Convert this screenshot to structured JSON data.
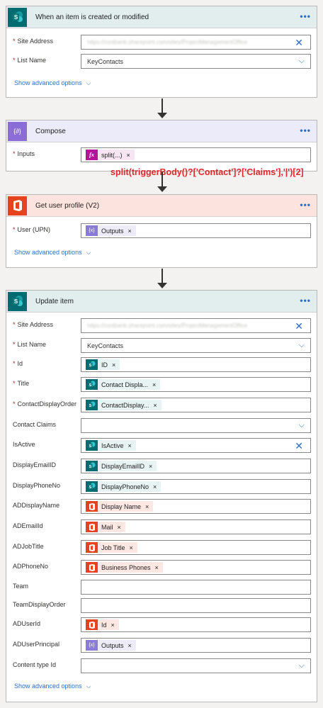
{
  "colors": {
    "sharepoint": "#036c70",
    "office": "#e6421d",
    "compose": "#8c6cd6",
    "variable": "#8a7bd8",
    "accent": "#2b6fc4",
    "annotation": "#e0282d"
  },
  "trigger": {
    "title": "When an item is created or modified",
    "icon": "sharepoint-icon",
    "fields": [
      {
        "label": "Site Address",
        "required": true,
        "value": "https://coolbank.sharepoint.com/sites/ProjectManagementOffice"
      },
      {
        "label": "List Name",
        "required": true,
        "value": "KeyContacts"
      }
    ],
    "advanced": "Show advanced options"
  },
  "compose": {
    "title": "Compose",
    "icon": "compose-icon",
    "inputs_label": "Inputs",
    "token": "split(...)",
    "annotation": "split(triggerBody()?['Contact']?['Claims'],'|')[2]"
  },
  "profile": {
    "title": "Get user profile (V2)",
    "icon": "office365-icon",
    "user_label": "User (UPN)",
    "token": "Outputs",
    "advanced": "Show advanced options"
  },
  "update": {
    "title": "Update item",
    "icon": "sharepoint-icon",
    "fields": [
      {
        "label": "Site Address",
        "required": true,
        "kind": "text",
        "value": "https://coolbank.sharepoint.com/sites/ProjectManagementOffice",
        "control": "clear"
      },
      {
        "label": "List Name",
        "required": true,
        "kind": "text",
        "value": "KeyContacts",
        "control": "dropdown"
      },
      {
        "label": "Id",
        "required": true,
        "kind": "token",
        "icon": "sp",
        "token": "ID"
      },
      {
        "label": "Title",
        "required": true,
        "kind": "token",
        "icon": "sp",
        "token": "Contact Displa..."
      },
      {
        "label": "ContactDisplayOrder",
        "required": true,
        "kind": "token",
        "icon": "sp",
        "token": "ContactDisplay..."
      },
      {
        "label": "Contact Claims",
        "required": false,
        "kind": "empty",
        "control": "dropdown"
      },
      {
        "label": "IsActive",
        "required": false,
        "kind": "token",
        "icon": "sp",
        "token": "IsActive",
        "control": "clear"
      },
      {
        "label": "DisplayEmailID",
        "required": false,
        "kind": "token",
        "icon": "sp",
        "token": "DisplayEmailID"
      },
      {
        "label": "DisplayPhoneNo",
        "required": false,
        "kind": "token",
        "icon": "sp",
        "token": "DisplayPhoneNo"
      },
      {
        "label": "ADDisplayName",
        "required": false,
        "kind": "token",
        "icon": "o365",
        "token": "Display Name"
      },
      {
        "label": "ADEmailId",
        "required": false,
        "kind": "token",
        "icon": "o365",
        "token": "Mail"
      },
      {
        "label": "ADJobTitle",
        "required": false,
        "kind": "token",
        "icon": "o365",
        "token": "Job Title"
      },
      {
        "label": "ADPhoneNo",
        "required": false,
        "kind": "token",
        "icon": "o365",
        "token": "Business Phones"
      },
      {
        "label": "Team",
        "required": false,
        "kind": "empty"
      },
      {
        "label": "TeamDisplayOrder",
        "required": false,
        "kind": "empty"
      },
      {
        "label": "ADUserId",
        "required": false,
        "kind": "token",
        "icon": "o365",
        "token": "Id"
      },
      {
        "label": "ADUserPrincipal",
        "required": false,
        "kind": "token",
        "icon": "var",
        "token": "Outputs"
      },
      {
        "label": "Content type Id",
        "required": false,
        "kind": "empty",
        "control": "dropdown"
      }
    ],
    "advanced": "Show advanced options"
  },
  "glyphs": {
    "more": "•••",
    "chevron": "⌵",
    "clear": "✕",
    "token_remove": "×",
    "fx": "fx",
    "var": "{x}"
  }
}
